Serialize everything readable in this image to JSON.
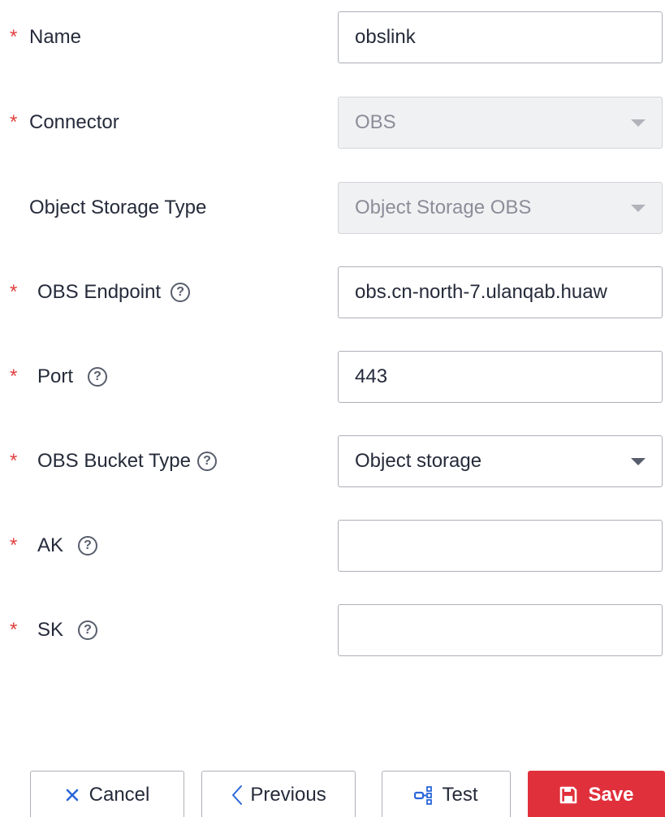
{
  "form": {
    "name": {
      "label": "Name",
      "value": "obslink",
      "required": true
    },
    "connector": {
      "label": "Connector",
      "value": "OBS",
      "required": true,
      "disabled": true
    },
    "object_storage_type": {
      "label": "Object Storage Type",
      "value": "Object Storage OBS",
      "required": false,
      "disabled": true
    },
    "obs_endpoint": {
      "label": "OBS Endpoint",
      "value": "obs.cn-north-7.ulanqab.huaw",
      "required": true
    },
    "port": {
      "label": "Port",
      "value": "443",
      "required": true
    },
    "obs_bucket_type": {
      "label": "OBS Bucket Type",
      "value": "Object storage",
      "required": true
    },
    "ak": {
      "label": "AK",
      "value": "",
      "required": true
    },
    "sk": {
      "label": "SK",
      "value": "",
      "required": true
    },
    "required_mark": "*",
    "help_glyph": "?"
  },
  "actions": {
    "cancel_label": "Cancel",
    "previous_label": "Previous",
    "test_label": "Test",
    "save_label": "Save"
  },
  "colors": {
    "required": "#e0403e",
    "save_bg": "#e0303c",
    "border": "#adb0b8",
    "cancel_icon": "#2a66d9"
  },
  "icons": {
    "cancel": "close-icon",
    "previous": "chevron-left-icon",
    "test": "connection-test-icon",
    "save": "save-icon",
    "help": "help-circle-icon",
    "dropdown": "caret-down-icon"
  }
}
